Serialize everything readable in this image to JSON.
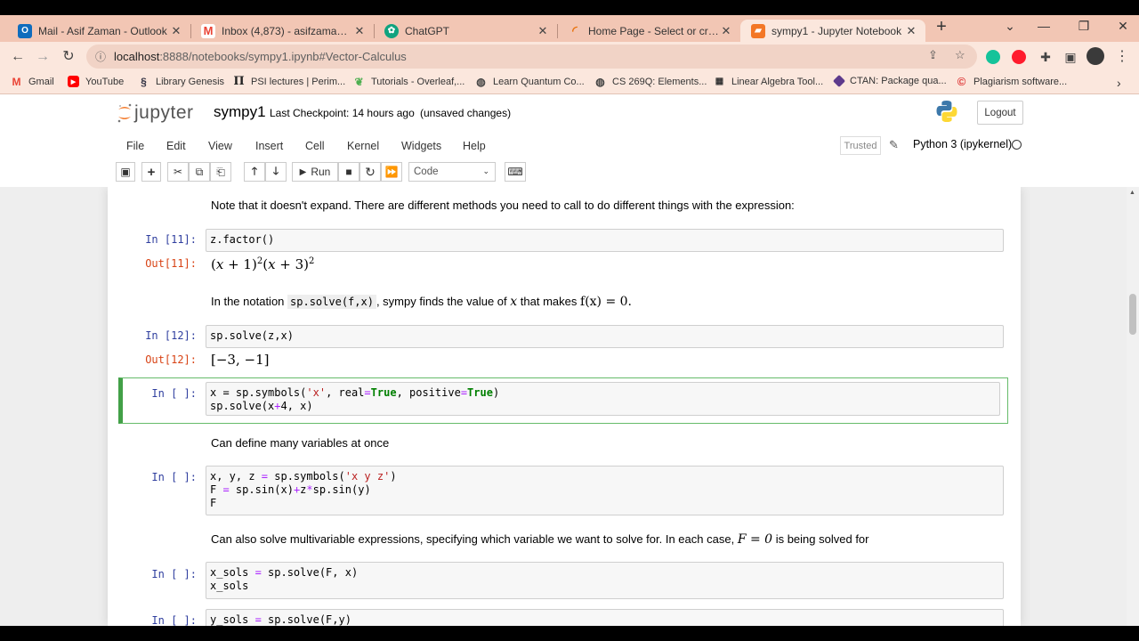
{
  "browser": {
    "tabs": [
      {
        "title": "Mail - Asif Zaman - Outlook",
        "icon": "outlook-icon",
        "color": "#0f6cbd"
      },
      {
        "title": "Inbox (4,873) - asifzaman@icp...",
        "icon": "gmail-icon",
        "color": "#ea4335"
      },
      {
        "title": "ChatGPT",
        "icon": "chatgpt-icon",
        "color": "#10a37f"
      },
      {
        "title": "Home Page - Select or create a...",
        "icon": "overleaf-spinner-icon",
        "color": "#e8710a"
      },
      {
        "title": "sympy1 - Jupyter Notebook",
        "icon": "jupyter-icon",
        "color": "#f37726"
      }
    ],
    "new_tab": "+",
    "url_host": "localhost",
    "url_rest": ":8888/notebooks/sympy1.ipynb#Vector-Calculus",
    "bookmarks": [
      {
        "label": "Gmail",
        "icon": "gmail-icon"
      },
      {
        "label": "YouTube",
        "icon": "youtube-icon"
      },
      {
        "label": "Library Genesis",
        "icon": "library-icon"
      },
      {
        "label": "PSI lectures | Perim...",
        "icon": "pi-icon"
      },
      {
        "label": "Tutorials - Overleaf,...",
        "icon": "overleaf-icon"
      },
      {
        "label": "Learn Quantum Co...",
        "icon": "globe-icon"
      },
      {
        "label": "CS 269Q: Elements...",
        "icon": "globe-icon"
      },
      {
        "label": "Linear Algebra Tool...",
        "icon": "toolkit-icon"
      },
      {
        "label": "CTAN: Package qua...",
        "icon": "ctan-icon"
      },
      {
        "label": "Plagiarism software...",
        "icon": "copyright-icon"
      }
    ]
  },
  "jupyter": {
    "logo_text": "jupyter",
    "notebook_name": "sympy1",
    "checkpoint": "Last Checkpoint: 14 hours ago",
    "unsaved": "(unsaved changes)",
    "logout": "Logout",
    "menus": [
      "File",
      "Edit",
      "View",
      "Insert",
      "Cell",
      "Kernel",
      "Widgets",
      "Help"
    ],
    "trusted": "Trusted",
    "kernel_name": "Python 3 (ipykernel)",
    "run_label": "Run",
    "cell_type": "Code"
  },
  "cells": {
    "md_top": "Note that it doesn't expand. There are different methods you need to call to do different things with the expression:",
    "in11_prompt": "In [11]:",
    "in11_code": "z.factor()",
    "out11_prompt": "Out[11]:",
    "md_notation_pre": "In the notation",
    "md_notation_code": "sp.solve(f,x)",
    "md_notation_mid": ", sympy finds the value of",
    "md_notation_var": "x",
    "md_notation_post": "that makes",
    "md_notation_eq": "f(x) = 0.",
    "in12_prompt": "In [12]:",
    "in12_code": "sp.solve(z,x)",
    "out12_prompt": "Out[12]:",
    "out12_value": "[−3,  −1]",
    "sel_prompt": "In [ ]:",
    "md_many": "Can define many variables at once",
    "in_a_prompt": "In [ ]:",
    "md_multi": "Can also solve multivariable expressions, specifying which variable we want to solve for. In each case,",
    "md_multi_eq": "F = 0",
    "md_multi_post": "is being solved for",
    "in_b_prompt": "In [ ]:",
    "in_c_prompt": "In [ ]:"
  }
}
